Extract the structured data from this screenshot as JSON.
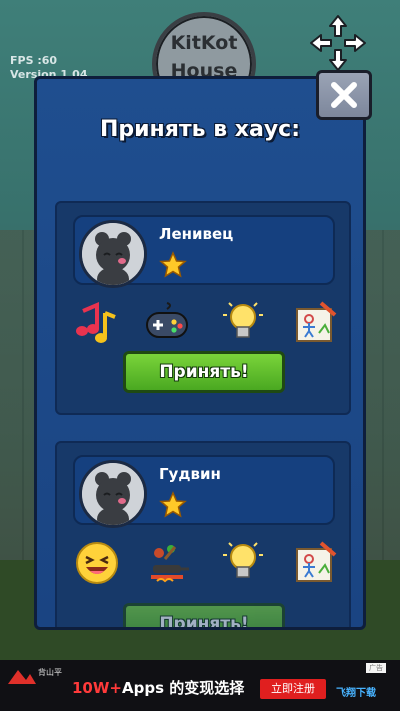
{
  "game": {
    "sign": {
      "line1": "KitKot",
      "line2": "House"
    },
    "fps_label": "FPS :60",
    "version_label": "Version 1.04"
  },
  "dialog": {
    "title": "Принять в хаус:",
    "requests": [
      {
        "name": "Ленивец",
        "stars": 1,
        "interests": [
          "music-notes-icon",
          "gamepad-icon",
          "lightbulb-icon",
          "drawing-icon"
        ],
        "accept_label": "Принять!"
      },
      {
        "name": "Гудвин",
        "stars": 1,
        "interests": [
          "laughing-face-icon",
          "cooking-icon",
          "lightbulb-icon",
          "drawing-icon"
        ],
        "accept_label": "Принять!"
      }
    ]
  },
  "ad": {
    "brand": "背山平",
    "headline_accent": "10W+",
    "headline_rest": "Apps 的变现选择",
    "cta": "立即注册",
    "badge": "广告",
    "site": "飞翔下载"
  },
  "colors": {
    "panel": "#1f4e8f",
    "accept_green": "#4aa821",
    "close_gray": "#8a93a8"
  }
}
